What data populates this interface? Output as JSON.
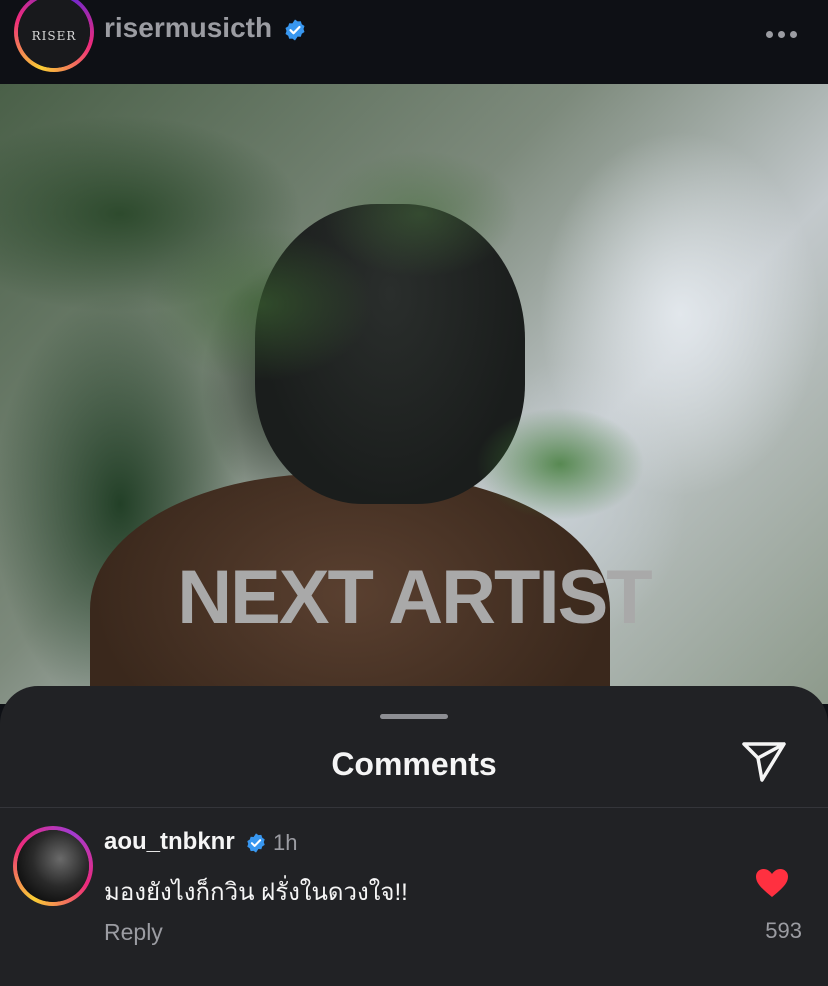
{
  "header": {
    "username": "risermusicth",
    "avatar_logo": "RISER",
    "verified_icon": "verified-badge-icon",
    "more_icon": "more-horizontal-icon"
  },
  "post": {
    "overlay_text": "NEXT ARTIST"
  },
  "comments_sheet": {
    "title": "Comments",
    "share_icon": "send-paper-plane-icon",
    "comments": [
      {
        "username": "aou_tnbknr",
        "verified": true,
        "time": "1h",
        "text": "มองยังไงก็กวิน ฝรั่งในดวงใจ!!",
        "reply_label": "Reply",
        "like_count": "593",
        "liked": true
      }
    ]
  },
  "colors": {
    "background": "#0e1015",
    "sheet": "#212225",
    "muted_text": "#9b9ca2",
    "verified_blue": "#3897f0",
    "like_red": "#ff3040"
  }
}
